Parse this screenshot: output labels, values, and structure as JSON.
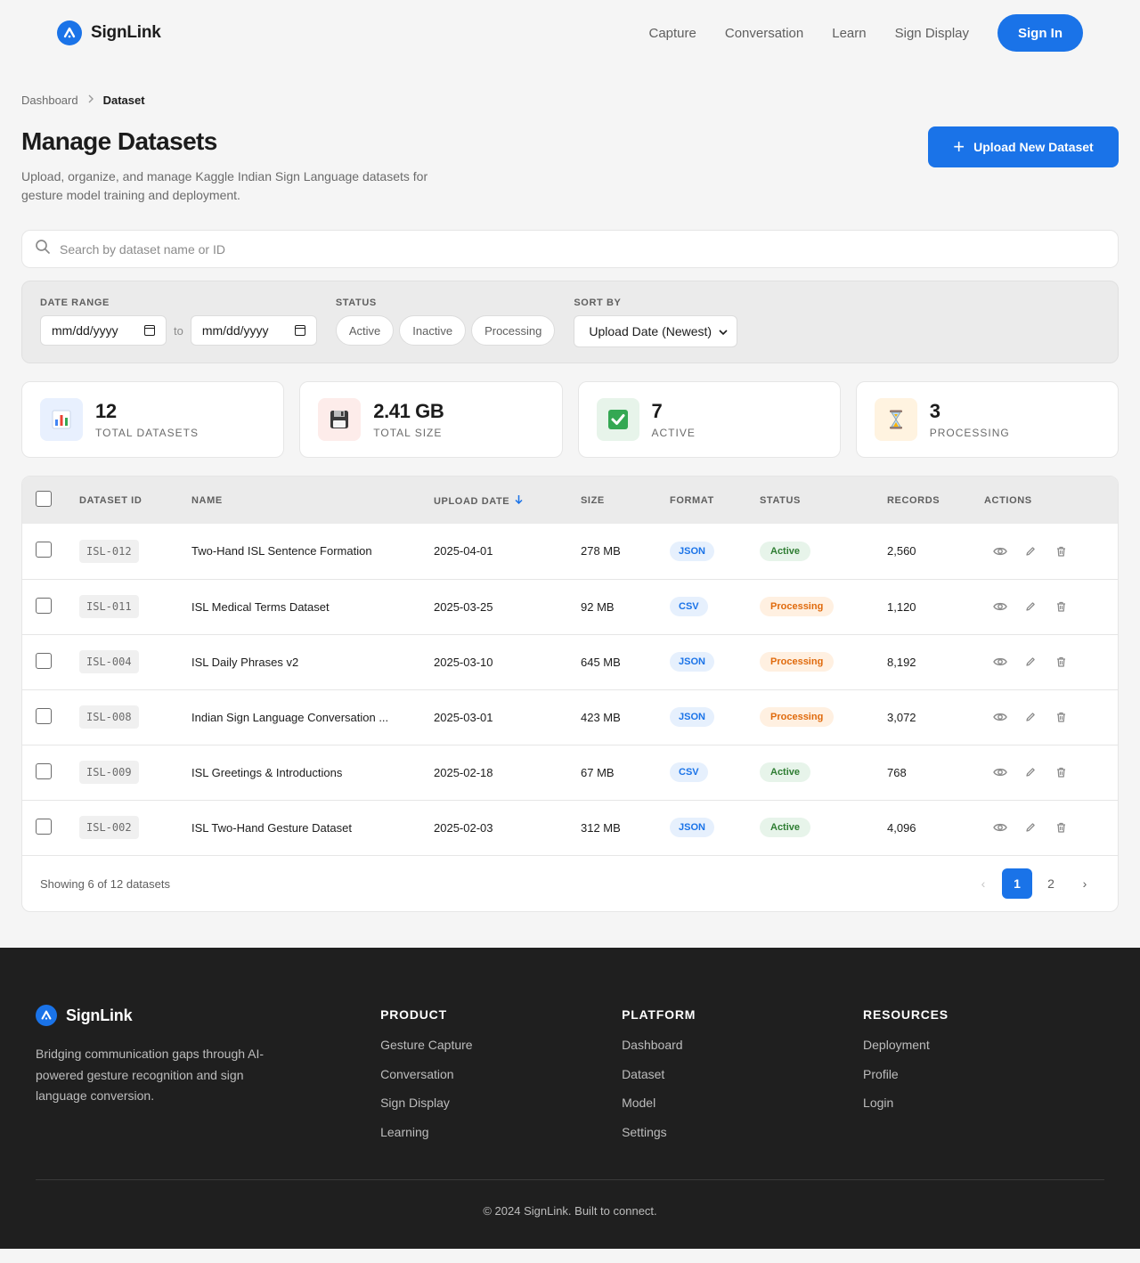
{
  "brand": {
    "name": "SignLink"
  },
  "nav": {
    "items": [
      "Capture",
      "Conversation",
      "Learn",
      "Sign Display"
    ],
    "signin_label": "Sign In"
  },
  "breadcrumb": {
    "parent": "Dashboard",
    "current": "Dataset"
  },
  "page": {
    "title": "Manage Datasets",
    "subtitle": "Upload, organize, and manage Kaggle Indian Sign Language datasets for gesture model training and deployment.",
    "upload_label": "Upload New Dataset"
  },
  "search": {
    "placeholder": "Search by dataset name or ID"
  },
  "filters": {
    "date_range_label": "DATE RANGE",
    "date_from": "mm/dd/yyyy",
    "date_to": "mm/dd/yyyy",
    "to_label": "to",
    "status_label": "STATUS",
    "status_options": [
      "Active",
      "Inactive",
      "Processing"
    ],
    "sort_label": "SORT BY",
    "sort_value": "Upload Date (Newest)"
  },
  "stats": [
    {
      "icon": "bar-chart-icon",
      "value": "12",
      "label": "TOTAL DATASETS",
      "bg": "#e8f0fe"
    },
    {
      "icon": "floppy-disk-icon",
      "value": "2.41 GB",
      "label": "TOTAL SIZE",
      "bg": "#fdecea"
    },
    {
      "icon": "check-mark-icon",
      "value": "7",
      "label": "ACTIVE",
      "bg": "#e7f4ea"
    },
    {
      "icon": "hourglass-icon",
      "value": "3",
      "label": "PROCESSING",
      "bg": "#fff3e0"
    }
  ],
  "table": {
    "headers": {
      "id": "DATASET ID",
      "name": "NAME",
      "date": "UPLOAD DATE",
      "size": "SIZE",
      "format": "FORMAT",
      "status": "STATUS",
      "records": "RECORDS",
      "actions": "ACTIONS"
    },
    "rows": [
      {
        "id": "ISL-012",
        "name": "Two-Hand ISL Sentence Formation",
        "date": "2025-04-01",
        "size": "278 MB",
        "format": "JSON",
        "status": "Active",
        "records": "2,560"
      },
      {
        "id": "ISL-011",
        "name": "ISL Medical Terms Dataset",
        "date": "2025-03-25",
        "size": "92 MB",
        "format": "CSV",
        "status": "Processing",
        "records": "1,120"
      },
      {
        "id": "ISL-004",
        "name": "ISL Daily Phrases v2",
        "date": "2025-03-10",
        "size": "645 MB",
        "format": "JSON",
        "status": "Processing",
        "records": "8,192"
      },
      {
        "id": "ISL-008",
        "name": "Indian Sign Language Conversation ...",
        "date": "2025-03-01",
        "size": "423 MB",
        "format": "JSON",
        "status": "Processing",
        "records": "3,072"
      },
      {
        "id": "ISL-009",
        "name": "ISL Greetings & Introductions",
        "date": "2025-02-18",
        "size": "67 MB",
        "format": "CSV",
        "status": "Active",
        "records": "768"
      },
      {
        "id": "ISL-002",
        "name": "ISL Two-Hand Gesture Dataset",
        "date": "2025-02-03",
        "size": "312 MB",
        "format": "JSON",
        "status": "Active",
        "records": "4,096"
      }
    ],
    "showing": "Showing 6 of 12 datasets",
    "pages": [
      "1",
      "2"
    ],
    "prev": "‹",
    "next": "›"
  },
  "footer": {
    "brand": "SignLink",
    "description": "Bridging communication gaps through AI-powered gesture recognition and sign language conversion.",
    "columns": [
      {
        "title": "PRODUCT",
        "links": [
          "Gesture Capture",
          "Conversation",
          "Sign Display",
          "Learning"
        ]
      },
      {
        "title": "PLATFORM",
        "links": [
          "Dashboard",
          "Dataset",
          "Model",
          "Settings"
        ]
      },
      {
        "title": "RESOURCES",
        "links": [
          "Deployment",
          "Profile",
          "Login"
        ]
      }
    ],
    "copyright": "© 2024 SignLink. Built to connect."
  },
  "colors": {
    "accent": "#1a73e8",
    "active": "#2e7d32",
    "processing": "#e06a0c",
    "footer_bg": "#1f1f1f"
  }
}
